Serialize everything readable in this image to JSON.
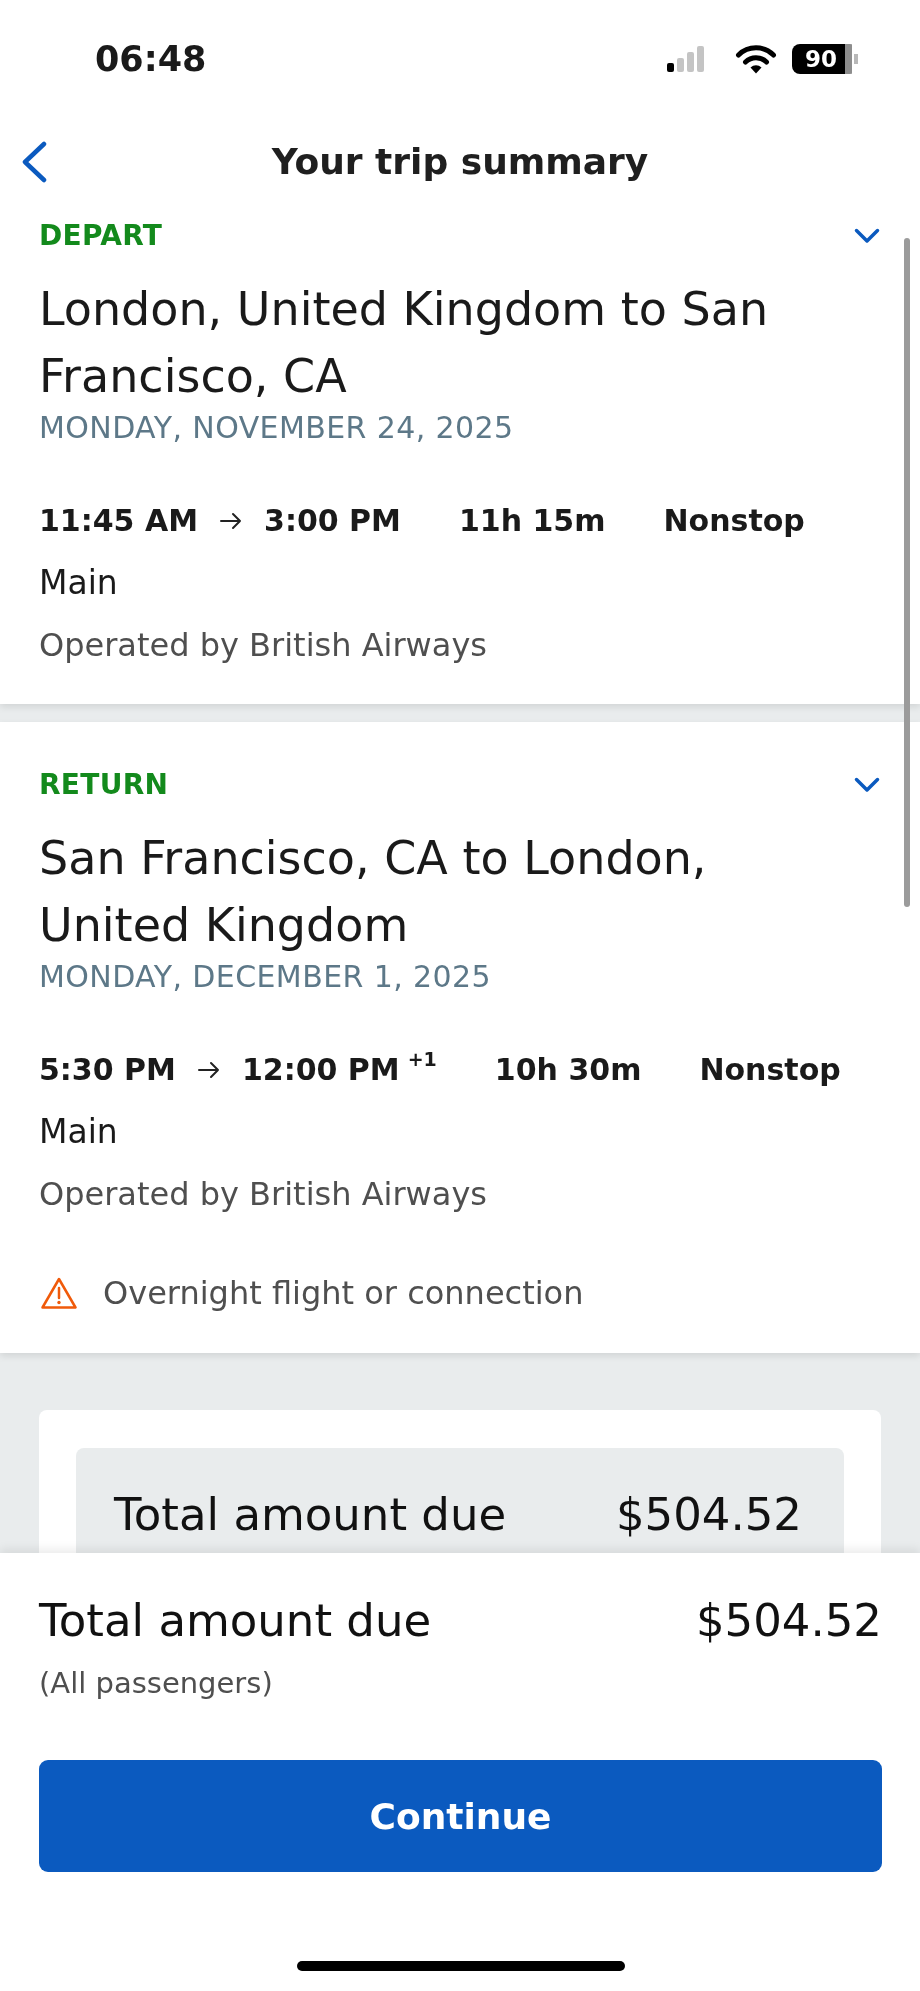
{
  "status_bar": {
    "time": "06:48",
    "battery": "90"
  },
  "header": {
    "title": "Your trip summary"
  },
  "flights": [
    {
      "label": "DEPART",
      "route": "London, United Kingdom to San Francisco, CA",
      "date": "MONDAY, NOVEMBER 24, 2025",
      "depart_time": "11:45 AM",
      "arrive_time": "3:00 PM",
      "duration": "11h 15m",
      "stops": "Nonstop",
      "cabin": "Main",
      "operator": "Operated by British Airways"
    },
    {
      "label": "RETURN",
      "route": "San Francisco, CA to London, United Kingdom",
      "date": "MONDAY, DECEMBER 1, 2025",
      "depart_time": "5:30 PM",
      "arrive_time": "12:00 PM",
      "day_offset": "+1",
      "duration": "10h 30m",
      "stops": "Nonstop",
      "cabin": "Main",
      "operator": "Operated by British Airways",
      "notice": "Overnight flight or connection"
    }
  ],
  "price_summary": {
    "label": "Total amount due",
    "amount": "$504.52"
  },
  "footer": {
    "label": "Total amount due",
    "amount": "$504.52",
    "note": "(All passengers)",
    "button": "Continue"
  }
}
